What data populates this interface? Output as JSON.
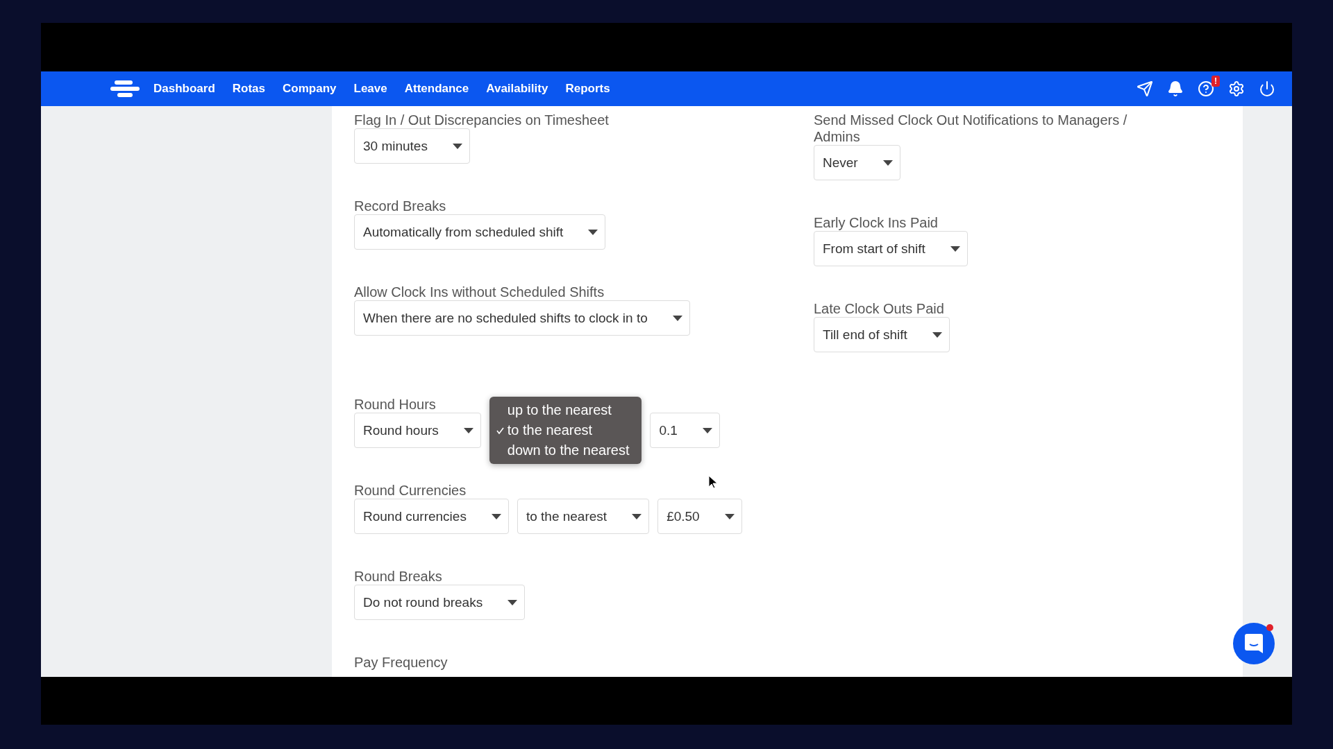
{
  "nav": {
    "items": [
      {
        "label": "Dashboard"
      },
      {
        "label": "Rotas"
      },
      {
        "label": "Company"
      },
      {
        "label": "Leave"
      },
      {
        "label": "Attendance"
      },
      {
        "label": "Availability"
      },
      {
        "label": "Reports"
      }
    ],
    "help_badge": "!"
  },
  "left": [
    {
      "label": "Flag In / Out Discrepancies on Timesheet",
      "controls": [
        {
          "kind": "select",
          "value": "30 minutes"
        }
      ]
    },
    {
      "label": "Record Breaks",
      "controls": [
        {
          "kind": "select",
          "value": "Automatically from scheduled shift"
        }
      ]
    },
    {
      "label": "Allow Clock Ins without Scheduled Shifts",
      "controls": [
        {
          "kind": "select",
          "value": "When there are no scheduled shifts to clock in to"
        }
      ]
    },
    {
      "label": "Round Hours",
      "controls": [
        {
          "kind": "select",
          "value": "Round hours"
        },
        {
          "kind": "menu",
          "options": [
            {
              "label": "up to the nearest",
              "selected": false
            },
            {
              "label": "to the nearest",
              "selected": true
            },
            {
              "label": "down to the nearest",
              "selected": false
            }
          ]
        },
        {
          "kind": "select",
          "value": "0.1"
        }
      ]
    },
    {
      "label": "Round Currencies",
      "controls": [
        {
          "kind": "select",
          "value": "Round currencies"
        },
        {
          "kind": "select",
          "value": "to the nearest"
        },
        {
          "kind": "select",
          "value": "£0.50"
        }
      ]
    },
    {
      "label": "Round Breaks",
      "controls": [
        {
          "kind": "select",
          "value": "Do not round breaks"
        }
      ]
    },
    {
      "label": "Pay Frequency"
    }
  ],
  "right": [
    {
      "label": "Send Missed Clock Out Notifications to Managers / Admins",
      "controls": [
        {
          "kind": "select",
          "value": "Never"
        }
      ]
    },
    {
      "label": "Early Clock Ins Paid",
      "controls": [
        {
          "kind": "select",
          "value": "From start of shift"
        }
      ]
    },
    {
      "label": "Late Clock Outs Paid",
      "controls": [
        {
          "kind": "select",
          "value": "Till end of shift"
        }
      ]
    }
  ]
}
